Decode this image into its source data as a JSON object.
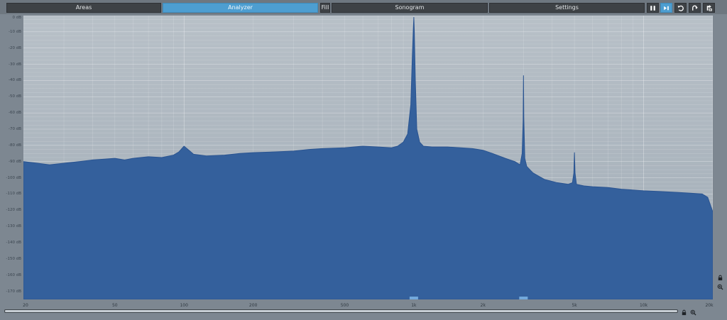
{
  "tabs": [
    {
      "label": "Areas",
      "active": false
    },
    {
      "label": "Analyzer",
      "active": true
    },
    {
      "label": "Fill",
      "active": false
    },
    {
      "label": "Sonogram",
      "active": false
    },
    {
      "label": "Settings",
      "active": false
    }
  ],
  "toolbar": [
    {
      "icon": "pause-icon",
      "active": false
    },
    {
      "icon": "step-forward-icon",
      "active": true
    },
    {
      "icon": "undo-icon",
      "active": false
    },
    {
      "icon": "redo-icon",
      "active": false
    },
    {
      "icon": "export-icon",
      "active": false
    }
  ],
  "side_buttons": [
    {
      "icon": "lock-icon"
    },
    {
      "icon": "zoom-icon"
    }
  ],
  "bottom_buttons": [
    {
      "icon": "lock-icon"
    },
    {
      "icon": "zoom-icon"
    }
  ],
  "colors": {
    "spectrum_fill": "#34609c",
    "spectrum_top": "#2a5491",
    "plot_background": "#aab4bd",
    "active_tab": "#4d9ed1",
    "marker": "#7fb6e8"
  },
  "scrollbar": {
    "position_fraction": 0.0,
    "visible_fraction": 1.0
  },
  "chart_data": {
    "type": "area",
    "x_scale": "log",
    "xlim": [
      20,
      20000
    ],
    "ylim": [
      -175,
      0
    ],
    "y_unit": "dB",
    "y_ticks": [
      0,
      -10,
      -20,
      -30,
      -40,
      -50,
      -60,
      -70,
      -80,
      -90,
      -100,
      -110,
      -120,
      -130,
      -140,
      -150,
      -160,
      -170
    ],
    "y_tick_labels": [
      "0 dB",
      "-10 dB",
      "-20 dB",
      "-30 dB",
      "-40 dB",
      "-50 dB",
      "-60 dB",
      "-70 dB",
      "-80 dB",
      "-90 dB",
      "-100 dB",
      "-110 dB",
      "-120 dB",
      "-130 dB",
      "-140 dB",
      "-150 dB",
      "-160 dB",
      "-170 dB"
    ],
    "x_ticks": [
      20,
      50,
      100,
      200,
      500,
      1000,
      2000,
      5000,
      10000,
      20000
    ],
    "x_tick_labels": [
      "20",
      "50",
      "100",
      "200",
      "500",
      "1k",
      "2k",
      "5k",
      "10k",
      "20k"
    ],
    "marker_frequencies": [
      1000,
      3000
    ],
    "spectrum": {
      "x": [
        20,
        23,
        26,
        30,
        35,
        40,
        45,
        50,
        55,
        60,
        70,
        80,
        90,
        95,
        100,
        105,
        110,
        125,
        150,
        175,
        200,
        250,
        300,
        350,
        400,
        500,
        600,
        700,
        800,
        850,
        900,
        940,
        970,
        985,
        995,
        1000,
        1005,
        1015,
        1030,
        1060,
        1100,
        1200,
        1400,
        1600,
        1800,
        2000,
        2200,
        2500,
        2750,
        2900,
        2960,
        2990,
        3000,
        3010,
        3040,
        3100,
        3300,
        3700,
        4200,
        4700,
        4900,
        4970,
        5000,
        5030,
        5100,
        5500,
        6000,
        7000,
        8000,
        10000,
        12000,
        14000,
        16000,
        18000,
        19000,
        20000
      ],
      "y": [
        -90,
        -91,
        -92,
        -91,
        -90,
        -89,
        -88.5,
        -88,
        -89,
        -88,
        -87,
        -87.5,
        -86,
        -84,
        -80.5,
        -83,
        -85.5,
        -86.5,
        -86,
        -85,
        -84.5,
        -84,
        -83.5,
        -82.5,
        -82,
        -81.5,
        -80.5,
        -81,
        -81.5,
        -80.5,
        -78,
        -73,
        -55,
        -25,
        -8,
        -1,
        -10,
        -40,
        -70,
        -78,
        -80.5,
        -81,
        -81,
        -81.5,
        -82,
        -83,
        -85,
        -88,
        -90,
        -92,
        -85,
        -65,
        -37,
        -63,
        -88,
        -93,
        -97,
        -101,
        -103,
        -104,
        -103,
        -97,
        -84.5,
        -97,
        -104,
        -105,
        -105.5,
        -106,
        -107,
        -108,
        -108.5,
        -109,
        -109.5,
        -110,
        -112,
        -121
      ]
    }
  }
}
